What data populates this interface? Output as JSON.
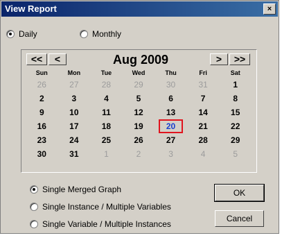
{
  "window": {
    "title": "View Report",
    "close_label": "×"
  },
  "period": {
    "daily_label": "Daily",
    "monthly_label": "Monthly",
    "selected": "Daily"
  },
  "calendar": {
    "prev_year_label": "<<",
    "prev_month_label": "<",
    "month_year": "Aug 2009",
    "next_month_label": ">",
    "next_year_label": ">>",
    "weekdays": [
      "Sun",
      "Mon",
      "Tue",
      "Wed",
      "Thu",
      "Fri",
      "Sat"
    ],
    "weeks": [
      [
        "26",
        "27",
        "28",
        "29",
        "30",
        "31",
        "1"
      ],
      [
        "2",
        "3",
        "4",
        "5",
        "6",
        "7",
        "8"
      ],
      [
        "9",
        "10",
        "11",
        "12",
        "13",
        "14",
        "15"
      ],
      [
        "16",
        "17",
        "18",
        "19",
        "20",
        "21",
        "22"
      ],
      [
        "23",
        "24",
        "25",
        "26",
        "27",
        "28",
        "29"
      ],
      [
        "30",
        "31",
        "1",
        "2",
        "3",
        "4",
        "5"
      ]
    ],
    "selected_day": "20"
  },
  "graph_options": {
    "single_merged": "Single Merged Graph",
    "instance_multi_vars": "Single Instance / Multiple Variables",
    "variable_multi_instances": "Single Variable / Multiple Instances",
    "selected": "Single Merged Graph"
  },
  "buttons": {
    "ok_label": "OK",
    "cancel_label": "Cancel"
  }
}
